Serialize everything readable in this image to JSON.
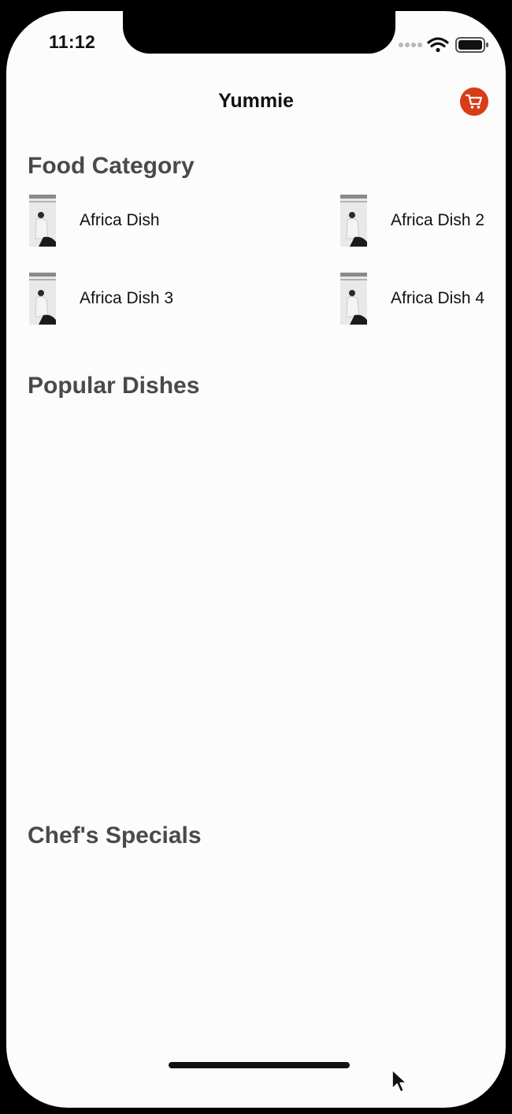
{
  "status_bar": {
    "time": "11:12",
    "icons": [
      "signal-dots-icon",
      "wifi-icon",
      "battery-icon"
    ]
  },
  "nav": {
    "title": "Yummie",
    "cart_icon": "cart-icon",
    "accent_color": "#d93c16"
  },
  "sections": {
    "food_category": "Food Category",
    "popular_dishes": "Popular Dishes",
    "chefs_specials": "Chef's Specials"
  },
  "categories": [
    {
      "label": "Africa Dish"
    },
    {
      "label": "Africa Dish 2"
    },
    {
      "label": "Africa Dish 3"
    },
    {
      "label": "Africa Dish 4"
    }
  ],
  "theme": {
    "background": "#fcfcfc",
    "section_title_color": "#4a4a4a",
    "text_color": "#111111"
  }
}
